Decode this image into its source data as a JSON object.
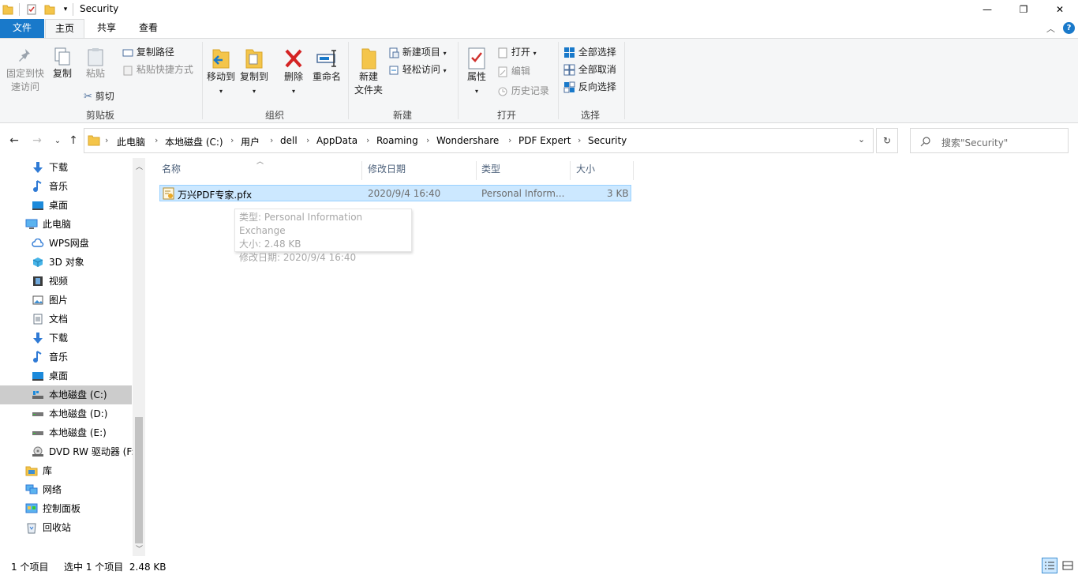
{
  "window": {
    "title": "Security",
    "minimize": "—",
    "maximize": "❐",
    "close": "✕"
  },
  "tabs": {
    "file": "文件",
    "home": "主页",
    "share": "共享",
    "view": "查看"
  },
  "ribbon": {
    "clipboard": {
      "pin_line1": "固定到快",
      "pin_line2": "速访问",
      "copy": "复制",
      "paste": "粘贴",
      "copy_path": "复制路径",
      "paste_shortcut": "粘贴快捷方式",
      "cut": "剪切",
      "label": "剪贴板"
    },
    "organize": {
      "move_to": "移动到",
      "copy_to": "复制到",
      "delete": "删除",
      "rename": "重命名",
      "label": "组织"
    },
    "new": {
      "new_folder_line1": "新建",
      "new_folder_line2": "文件夹",
      "new_item": "新建项目",
      "easy_access": "轻松访问",
      "label": "新建"
    },
    "open": {
      "properties": "属性",
      "open": "打开",
      "edit": "编辑",
      "history": "历史记录",
      "label": "打开"
    },
    "select": {
      "select_all": "全部选择",
      "select_none": "全部取消",
      "invert": "反向选择",
      "label": "选择"
    }
  },
  "address": {
    "crumbs": [
      "此电脑",
      "本地磁盘 (C:)",
      "用户",
      "dell",
      "AppData",
      "Roaming",
      "Wondershare",
      "PDF Expert",
      "Security"
    ],
    "search_placeholder": "搜索\"Security\""
  },
  "nav": {
    "items": [
      {
        "label": "下载",
        "icon": "download-icon"
      },
      {
        "label": "音乐",
        "icon": "music-icon"
      },
      {
        "label": "桌面",
        "icon": "desktop-icon"
      },
      {
        "label": "此电脑",
        "icon": "computer-icon"
      },
      {
        "label": "WPS网盘",
        "icon": "cloud-icon"
      },
      {
        "label": "3D 对象",
        "icon": "cube-icon"
      },
      {
        "label": "视频",
        "icon": "video-icon"
      },
      {
        "label": "图片",
        "icon": "picture-icon"
      },
      {
        "label": "文档",
        "icon": "document-icon"
      },
      {
        "label": "下载",
        "icon": "download-icon"
      },
      {
        "label": "音乐",
        "icon": "music-icon"
      },
      {
        "label": "桌面",
        "icon": "desktop-icon"
      },
      {
        "label": "本地磁盘 (C:)",
        "icon": "drive-icon"
      },
      {
        "label": "本地磁盘 (D:)",
        "icon": "drive-icon"
      },
      {
        "label": "本地磁盘 (E:)",
        "icon": "drive-icon"
      },
      {
        "label": "DVD RW 驱动器 (F:",
        "icon": "dvd-icon"
      },
      {
        "label": "库",
        "icon": "library-icon"
      },
      {
        "label": "网络",
        "icon": "network-icon"
      },
      {
        "label": "控制面板",
        "icon": "control-panel-icon"
      },
      {
        "label": "回收站",
        "icon": "recycle-bin-icon"
      }
    ]
  },
  "columns": {
    "name": "名称",
    "date": "修改日期",
    "type": "类型",
    "size": "大小"
  },
  "file": {
    "name": "万兴PDF专家.pfx",
    "date": "2020/9/4 16:40",
    "type": "Personal Inform...",
    "size": "3 KB"
  },
  "tooltip": {
    "line1": "类型: Personal Information Exchange",
    "line2": "大小: 2.48 KB",
    "line3": "修改日期: 2020/9/4 16:40"
  },
  "status": {
    "count": "1 个项目",
    "selected": "选中 1 个项目  2.48 KB"
  },
  "colors": {
    "accent": "#1979ca",
    "selection": "#cce8ff",
    "nav_selected": "#cccccc"
  }
}
